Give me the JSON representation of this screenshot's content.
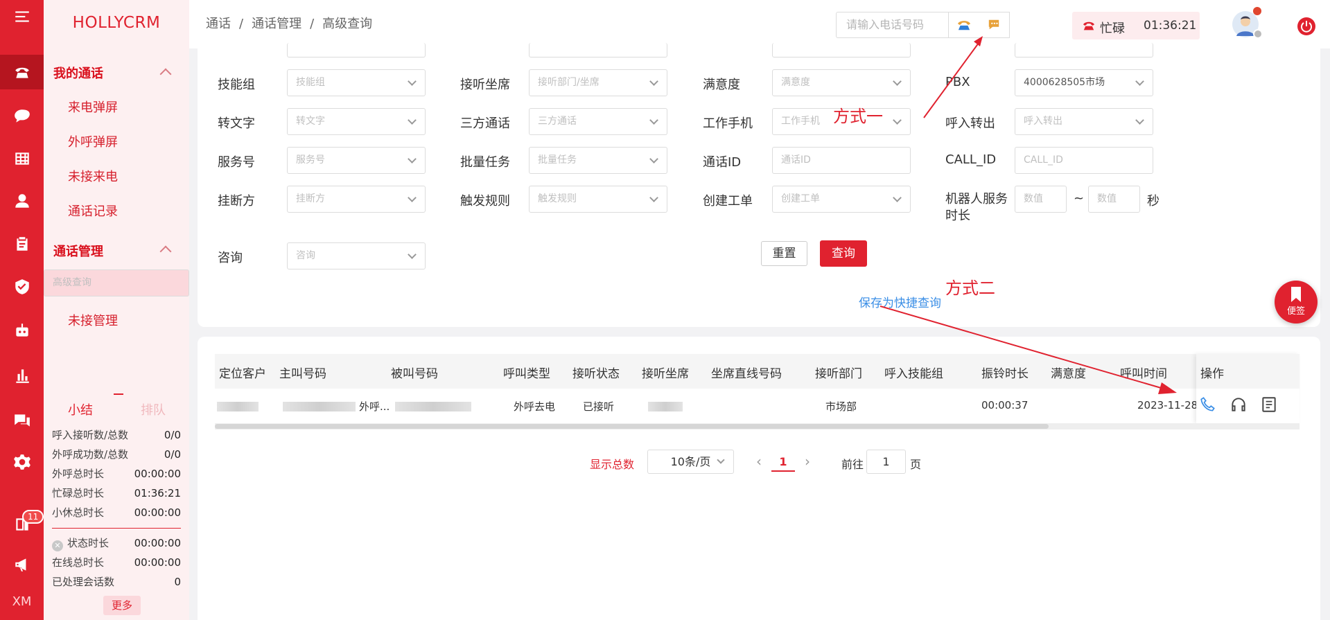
{
  "app": {
    "brand": "HOLLYCRM",
    "rail_extra": "XM",
    "rail_badge": "11"
  },
  "sidebar": {
    "groups": [
      {
        "label": "我的通话",
        "items": [
          "来电弹屏",
          "外呼弹屏",
          "未接来电",
          "通话记录"
        ]
      },
      {
        "label": "通话管理",
        "items": [
          "高级查询",
          "未接管理"
        ]
      }
    ],
    "selected_item": "高级查询",
    "stat_tabs": [
      "小结",
      "排队"
    ],
    "stats": [
      {
        "label": "呼入接听数/总数",
        "value": "0/0"
      },
      {
        "label": "外呼成功数/总数",
        "value": "0/0"
      },
      {
        "label": "外呼总时长",
        "value": "00:00:00"
      },
      {
        "label": "忙碌总时长",
        "value": "01:36:21"
      },
      {
        "label": "小休总时长",
        "value": "00:00:00"
      }
    ],
    "stats2": [
      {
        "label": "状态时长",
        "value": "00:00:00"
      },
      {
        "label": "在线总时长",
        "value": "00:00:00"
      },
      {
        "label": "已处理会话数",
        "value": "0"
      }
    ],
    "more_label": "更多"
  },
  "header": {
    "breadcrumb": [
      "通话",
      "通话管理",
      "高级查询"
    ],
    "breadcrumb_sep": "/",
    "phone_placeholder": "请输入电话号码",
    "status_label": "忙碌",
    "status_time": "01:36:21"
  },
  "filters": {
    "r1": [
      {
        "label": "技能组",
        "placeholder": "技能组"
      },
      {
        "label": "接听坐席",
        "placeholder": "接听部门/坐席"
      },
      {
        "label": "满意度",
        "placeholder": "满意度"
      },
      {
        "label": "PBX",
        "value": "4000628505市场"
      }
    ],
    "r2": [
      {
        "label": "转文字",
        "placeholder": "转文字"
      },
      {
        "label": "三方通话",
        "placeholder": "三方通话"
      },
      {
        "label": "工作手机",
        "placeholder": "工作手机"
      },
      {
        "label": "呼入转出",
        "placeholder": "呼入转出"
      }
    ],
    "r3": [
      {
        "label": "服务号",
        "placeholder": "服务号"
      },
      {
        "label": "批量任务",
        "placeholder": "批量任务"
      },
      {
        "label": "通话ID",
        "placeholder": "通话ID"
      },
      {
        "label": "CALL_ID",
        "placeholder": "CALL_ID"
      }
    ],
    "r4": [
      {
        "label": "挂断方",
        "placeholder": "挂断方"
      },
      {
        "label": "触发规则",
        "placeholder": "触发规则"
      },
      {
        "label": "创建工单",
        "placeholder": "创建工单"
      }
    ],
    "robot_label": "机器人服务时长",
    "robot_min_placeholder": "数值",
    "robot_max_placeholder": "数值",
    "robot_sep": "~",
    "robot_unit": "秒",
    "consult_label": "咨询",
    "consult_placeholder": "咨询",
    "save_label": "保存为快捷查询",
    "reset_label": "重置",
    "query_label": "查询"
  },
  "table": {
    "columns": [
      "定位客户",
      "主叫号码",
      "被叫号码",
      "呼叫类型",
      "接听状态",
      "接听坐席",
      "坐席直线号码",
      "接听部门",
      "呼入技能组",
      "振铃时长",
      "满意度",
      "呼叫时间"
    ],
    "ops_header": "操作",
    "row": {
      "caller_suffix": "外呼...",
      "call_type": "外呼去电",
      "answer_status": "已接听",
      "dept": "市场部",
      "ring": "00:00:37",
      "time": "2023-11-28"
    }
  },
  "pager": {
    "total_label": "显示总数",
    "page_size": "10条/页",
    "prev": "‹",
    "next": "›",
    "current": "1",
    "goto_label": "前往",
    "goto_value": "1",
    "page_unit": "页"
  },
  "annotations": {
    "method1": "方式一",
    "method2": "方式二"
  },
  "float_button": {
    "label": "便签"
  },
  "colors": {
    "brand": "#e0222f",
    "link": "#3a8ee6"
  }
}
